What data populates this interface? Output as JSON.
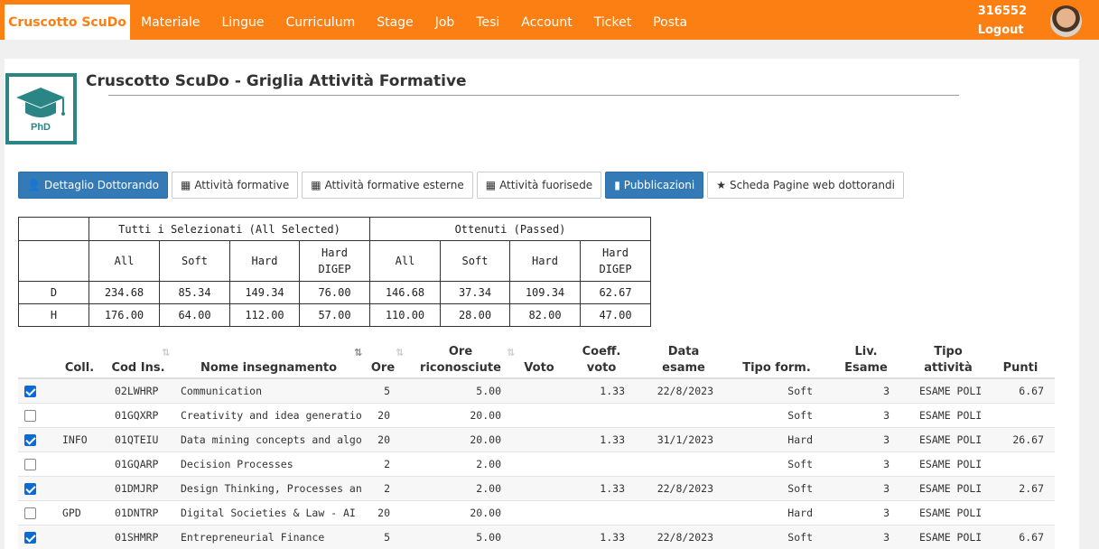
{
  "nav": {
    "brand": "Cruscotto ScuDo",
    "items": [
      "Materiale",
      "Lingue",
      "Curriculum",
      "Stage",
      "Job",
      "Tesi",
      "Account",
      "Ticket",
      "Posta"
    ],
    "user_id": "316552",
    "logout": "Logout"
  },
  "logo_text": "PhD",
  "page_title": "Cruscotto ScuDo - Griglia Attività  Formative",
  "tabs": [
    {
      "label": "Dettaglio Dottorando",
      "icon": "user-icon",
      "active": true
    },
    {
      "label": "Attività formative",
      "icon": "grid-icon",
      "active": false
    },
    {
      "label": "Attività formative esterne",
      "icon": "grid-icon",
      "active": false
    },
    {
      "label": "Attività fuorisede",
      "icon": "grid-icon",
      "active": false
    },
    {
      "label": "Pubblicazioni",
      "icon": "book-icon",
      "active": true
    },
    {
      "label": "Scheda Pagine web dottorandi",
      "icon": "star-icon",
      "active": false
    }
  ],
  "summary": {
    "group_all": "Tutti i Selezionati (All Selected)",
    "group_passed": "Ottenuti (Passed)",
    "cols": [
      "All",
      "Soft",
      "Hard",
      "Hard\nDIGEP",
      "All",
      "Soft",
      "Hard",
      "Hard\nDIGEP"
    ],
    "rows": [
      {
        "label": "D",
        "values": [
          "234.68",
          "85.34",
          "149.34",
          "76.00",
          "146.68",
          "37.34",
          "109.34",
          "62.67"
        ]
      },
      {
        "label": "H",
        "values": [
          "176.00",
          "64.00",
          "112.00",
          "57.00",
          "110.00",
          "28.00",
          "82.00",
          "47.00"
        ]
      }
    ]
  },
  "table": {
    "headers": {
      "coll": "Coll.",
      "cod": "Cod Ins.",
      "nome": "Nome insegnamento",
      "ore": "Ore",
      "ore_ric": "Ore\nriconosciute",
      "voto": "Voto",
      "coeff": "Coeff.\nvoto",
      "data": "Data\nesame",
      "tipo_form": "Tipo form.",
      "liv": "Liv.\nEsame",
      "tipo_att": "Tipo\nattività",
      "punti": "Punti"
    },
    "rows": [
      {
        "checked": true,
        "coll": "",
        "cod": "02LWHRP",
        "nome": "Communication",
        "ore": "5",
        "ore_ric": "5.00",
        "voto": "",
        "coeff": "1.33",
        "data": "22/8/2023",
        "tipo_form": "Soft",
        "liv": "3",
        "tipo_att": "ESAME POLI",
        "punti": "6.67"
      },
      {
        "checked": false,
        "coll": "",
        "cod": "01GQXRP",
        "nome": "Creativity and idea generatio…",
        "ore": "20",
        "ore_ric": "20.00",
        "voto": "",
        "coeff": "",
        "data": "",
        "tipo_form": "Soft",
        "liv": "3",
        "tipo_att": "ESAME POLI",
        "punti": ""
      },
      {
        "checked": true,
        "coll": "INFO",
        "cod": "01QTEIU",
        "nome": "Data mining concepts and algo…",
        "ore": "20",
        "ore_ric": "20.00",
        "voto": "",
        "coeff": "1.33",
        "data": "31/1/2023",
        "tipo_form": "Hard",
        "liv": "3",
        "tipo_att": "ESAME POLI",
        "punti": "26.67"
      },
      {
        "checked": false,
        "coll": "",
        "cod": "01GQARP",
        "nome": "Decision Processes",
        "ore": "2",
        "ore_ric": "2.00",
        "voto": "",
        "coeff": "",
        "data": "",
        "tipo_form": "Soft",
        "liv": "3",
        "tipo_att": "ESAME POLI",
        "punti": ""
      },
      {
        "checked": true,
        "coll": "",
        "cod": "01DMJRP",
        "nome": "Design Thinking, Processes an…",
        "ore": "2",
        "ore_ric": "2.00",
        "voto": "",
        "coeff": "1.33",
        "data": "22/8/2023",
        "tipo_form": "Soft",
        "liv": "3",
        "tipo_att": "ESAME POLI",
        "punti": "2.67"
      },
      {
        "checked": false,
        "coll": "GPD",
        "cod": "01DNTRP",
        "nome": "Digital Societies & Law - AI",
        "ore": "20",
        "ore_ric": "20.00",
        "voto": "",
        "coeff": "",
        "data": "",
        "tipo_form": "Hard",
        "liv": "3",
        "tipo_att": "ESAME POLI",
        "punti": ""
      },
      {
        "checked": true,
        "coll": "",
        "cod": "01SHMRP",
        "nome": "Entrepreneurial Finance",
        "ore": "5",
        "ore_ric": "5.00",
        "voto": "",
        "coeff": "1.33",
        "data": "22/8/2023",
        "tipo_form": "Soft",
        "liv": "3",
        "tipo_att": "ESAME POLI",
        "punti": "6.67"
      }
    ]
  },
  "colors": {
    "nav": "#fb7f12",
    "primary": "#337ab7",
    "logo": "#2b8585",
    "check": "#0a6bd6"
  }
}
